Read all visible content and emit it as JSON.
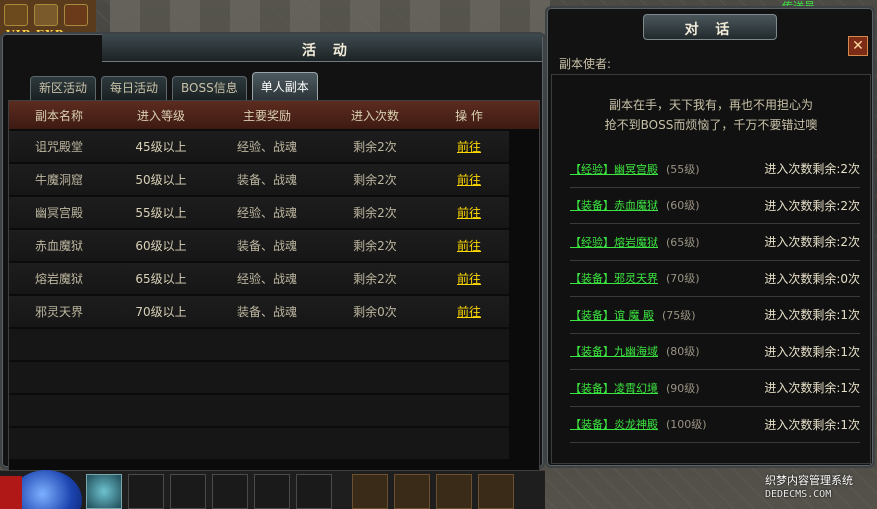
{
  "hud": {
    "vip_label": "VIP",
    "exp_label": "EXP"
  },
  "activity_panel": {
    "title": "活 动",
    "tabs": [
      {
        "label": "新区活动",
        "active": false
      },
      {
        "label": "每日活动",
        "active": false
      },
      {
        "label": "BOSS信息",
        "active": false
      },
      {
        "label": "单人副本",
        "active": true
      }
    ],
    "columns": [
      "副本名称",
      "进入等级",
      "主要奖励",
      "进入次数",
      "操 作"
    ],
    "rows": [
      {
        "name": "诅咒殿堂",
        "level": "45级以上",
        "reward": "经验、战魂",
        "times": "剩余2次",
        "action": "前往"
      },
      {
        "name": "牛魔洞窟",
        "level": "50级以上",
        "reward": "装备、战魂",
        "times": "剩余2次",
        "action": "前往"
      },
      {
        "name": "幽冥宫殿",
        "level": "55级以上",
        "reward": "经验、战魂",
        "times": "剩余2次",
        "action": "前往"
      },
      {
        "name": "赤血魔狱",
        "level": "60级以上",
        "reward": "装备、战魂",
        "times": "剩余2次",
        "action": "前往"
      },
      {
        "name": "熔岩魔狱",
        "level": "65级以上",
        "reward": "经验、战魂",
        "times": "剩余2次",
        "action": "前往"
      },
      {
        "name": "邪灵天界",
        "level": "70级以上",
        "reward": "装备、战魂",
        "times": "剩余0次",
        "action": "前往"
      }
    ]
  },
  "dialog": {
    "title": "对 话",
    "close_label": "✕",
    "npc_name": "副本使者:",
    "intro_line1": "副本在手，天下我有，再也不用担心为",
    "intro_line2": "抢不到BOSS而烦恼了，千万不要错过噢",
    "entries": [
      {
        "name": "【经验】幽冥宫殿",
        "level": "(55级)",
        "remain": "进入次数剩余:2次"
      },
      {
        "name": "【装备】赤血魔狱",
        "level": "(60级)",
        "remain": "进入次数剩余:2次"
      },
      {
        "name": "【经验】熔岩魔狱",
        "level": "(65级)",
        "remain": "进入次数剩余:2次"
      },
      {
        "name": "【装备】邪灵天界",
        "level": "(70级)",
        "remain": "进入次数剩余:0次"
      },
      {
        "name": "【装备】谊 魔 殿",
        "level": "(75级)",
        "remain": "进入次数剩余:1次"
      },
      {
        "name": "【装备】九幽海域",
        "level": "(80级)",
        "remain": "进入次数剩余:1次"
      },
      {
        "name": "【装备】凌霄幻境",
        "level": "(90级)",
        "remain": "进入次数剩余:1次"
      },
      {
        "name": "【装备】炎龙神殿",
        "level": "(100级)",
        "remain": "进入次数剩余:1次"
      }
    ]
  },
  "corner_label": "传送员",
  "watermark": {
    "line1": "织梦内容管理系统",
    "line2": "DEDECMS.COM"
  },
  "colors": {
    "link_yellow": "#ffd800",
    "link_green": "#3ce640",
    "header_red": "#5c2c20"
  }
}
